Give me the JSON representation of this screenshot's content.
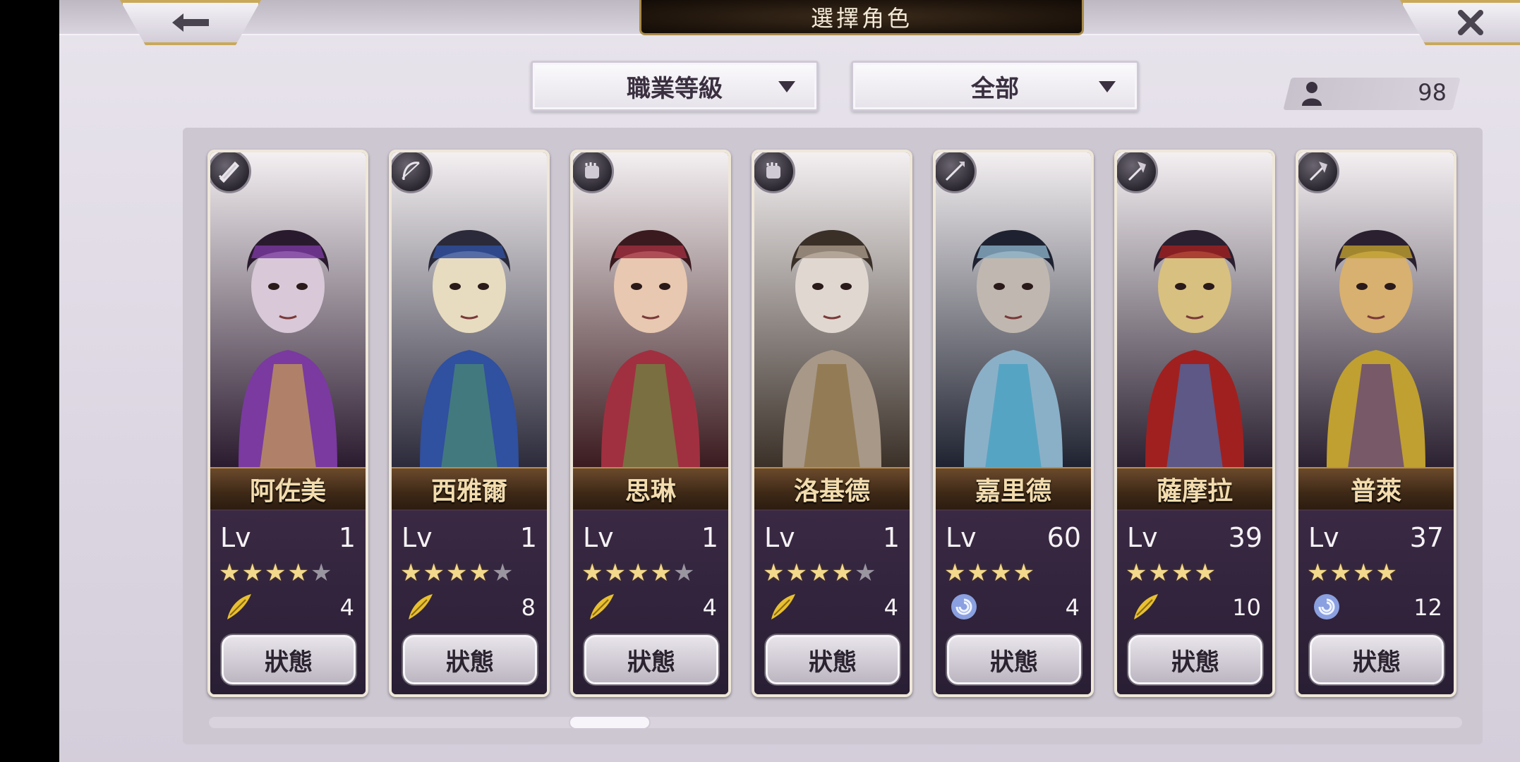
{
  "header": {
    "title": "選擇角色"
  },
  "filters": {
    "class_label": "職業等級",
    "scope_label": "全部"
  },
  "roster_count": "98",
  "cards": [
    {
      "name": "阿佐美",
      "lv_label": "Lv",
      "level": "1",
      "stars": 4,
      "max_stars": 5,
      "skill_icon": "feather-icon",
      "skill_value": "4",
      "status_label": "狀態",
      "class_icon": "sword-icon",
      "colors": [
        "#2a1a2e",
        "#7a3aa0",
        "#d8c8d8",
        "#c8a050"
      ]
    },
    {
      "name": "西雅爾",
      "lv_label": "Lv",
      "level": "1",
      "stars": 4,
      "max_stars": 5,
      "skill_icon": "feather-icon",
      "skill_value": "8",
      "status_label": "狀態",
      "class_icon": "bow-icon",
      "colors": [
        "#2b2a3a",
        "#3050a0",
        "#e8dcc0",
        "#4a8a70"
      ]
    },
    {
      "name": "思琳",
      "lv_label": "Lv",
      "level": "1",
      "stars": 4,
      "max_stars": 5,
      "skill_icon": "feather-icon",
      "skill_value": "4",
      "status_label": "狀態",
      "class_icon": "fist-icon",
      "colors": [
        "#3a1a1e",
        "#a03040",
        "#e8c8b0",
        "#6a8a40"
      ]
    },
    {
      "name": "洛基德",
      "lv_label": "Lv",
      "level": "1",
      "stars": 4,
      "max_stars": 5,
      "skill_icon": "feather-icon",
      "skill_value": "4",
      "status_label": "狀態",
      "class_icon": "fist-icon",
      "colors": [
        "#3a3028",
        "#a89888",
        "#e0d8d0",
        "#8a7040"
      ]
    },
    {
      "name": "嘉里德",
      "lv_label": "Lv",
      "level": "60",
      "stars": 4,
      "max_stars": 4,
      "skill_icon": "vortex-icon",
      "skill_value": "4",
      "status_label": "狀態",
      "class_icon": "spear-icon",
      "colors": [
        "#1e2230",
        "#8ab0c8",
        "#c0b8b0",
        "#40a0c0"
      ]
    },
    {
      "name": "薩摩拉",
      "lv_label": "Lv",
      "level": "39",
      "stars": 4,
      "max_stars": 4,
      "skill_icon": "feather-icon",
      "skill_value": "10",
      "status_label": "狀態",
      "class_icon": "axe-icon",
      "colors": [
        "#2a2030",
        "#a02020",
        "#d8c080",
        "#4070b0"
      ]
    },
    {
      "name": "普萊",
      "lv_label": "Lv",
      "level": "37",
      "stars": 4,
      "max_stars": 4,
      "skill_icon": "vortex-icon",
      "skill_value": "12",
      "status_label": "狀態",
      "class_icon": "axe-icon",
      "colors": [
        "#2a2030",
        "#c0a030",
        "#d8b070",
        "#5a3a80"
      ]
    }
  ]
}
